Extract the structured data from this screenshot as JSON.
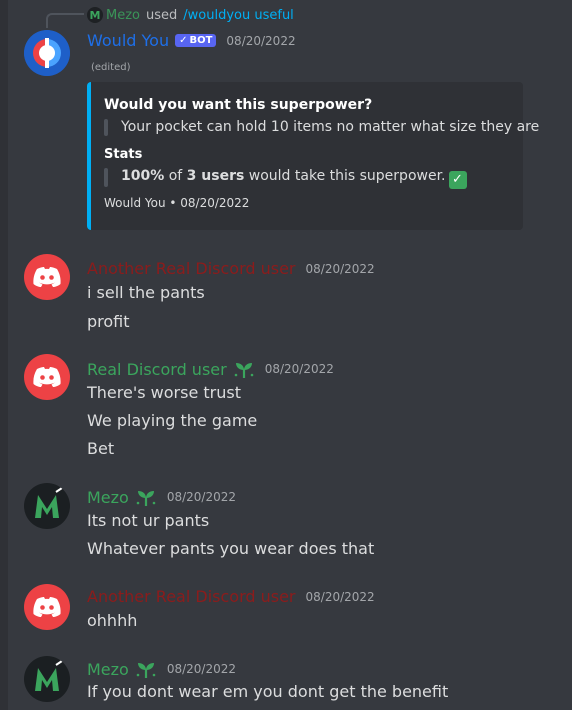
{
  "colors": {
    "green_name": "#3ba55d",
    "red_name": "#8b1c1c",
    "bot_name": "#1e6fe8",
    "command": "#00aff4",
    "bot_badge": "#5865f2"
  },
  "reply": {
    "user": "Mezo",
    "used": "used",
    "command": "/wouldyou useful"
  },
  "bot_message": {
    "username": "Would You",
    "badge": "BOT",
    "timestamp": "08/20/2022",
    "edited": "(edited)",
    "embed": {
      "title": "Would you want this superpower?",
      "question": "Your pocket can hold 10 items no matter what size they are",
      "stats_title": "Stats",
      "stats_pct": "100%",
      "stats_of": "of",
      "stats_users": "3 users",
      "stats_rest": "would take this superpower.",
      "footer": "Would You • 08/20/2022"
    }
  },
  "messages": [
    {
      "username": "Another Real Discord user",
      "timestamp": "08/20/2022",
      "lines": [
        "i sell the pants",
        "profit"
      ]
    },
    {
      "username": "Real Discord user",
      "timestamp": "08/20/2022",
      "lines": [
        "There's worse trust",
        "We playing the game",
        "Bet"
      ]
    },
    {
      "username": "Mezo",
      "timestamp": "08/20/2022",
      "lines": [
        "Its not ur pants",
        "Whatever pants you wear does that"
      ]
    },
    {
      "username": "Another Real Discord user",
      "timestamp": "08/20/2022",
      "lines": [
        "ohhhh"
      ]
    },
    {
      "username": "Mezo",
      "timestamp": "08/20/2022",
      "lines": [
        "If you dont wear em you dont get the benefit"
      ]
    }
  ]
}
